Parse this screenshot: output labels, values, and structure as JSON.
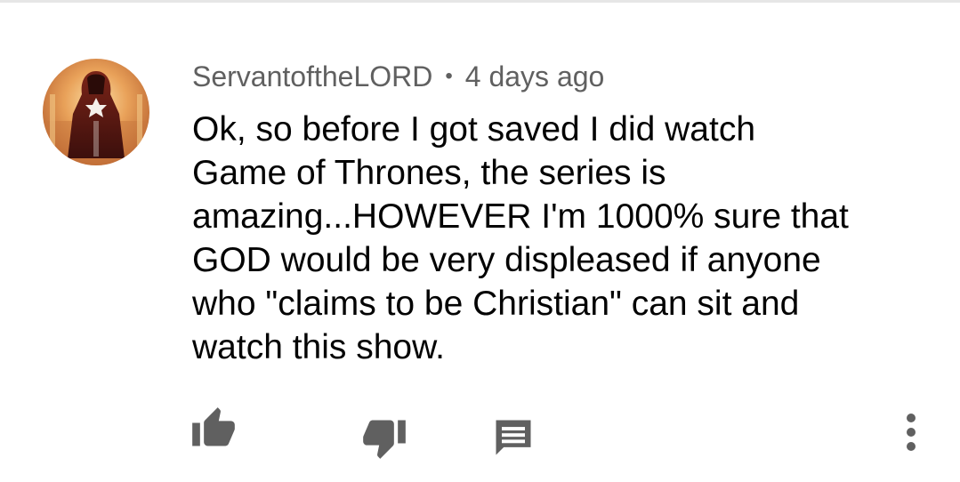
{
  "comment": {
    "author": "ServantoftheLORD",
    "separator": "•",
    "timestamp": "4 days ago",
    "text_lines": [
      "Ok, so before I got saved I did watch",
      "Game of Thrones, the series is",
      "amazing...HOWEVER I'm 1000% sure that",
      "GOD would be very displeased if anyone",
      "who \"claims to be Christian\" can sit and",
      "watch this show."
    ],
    "avatar": {
      "icon": "robed-figure-avatar",
      "colors": [
        "#e9a25a",
        "#b33a1c",
        "#5a1a14"
      ]
    }
  },
  "actions": {
    "like_icon": "thumbs-up-icon",
    "dislike_icon": "thumbs-down-icon",
    "reply_icon": "reply-comment-icon",
    "more_icon": "more-vertical-icon",
    "icon_color": "#606060"
  }
}
